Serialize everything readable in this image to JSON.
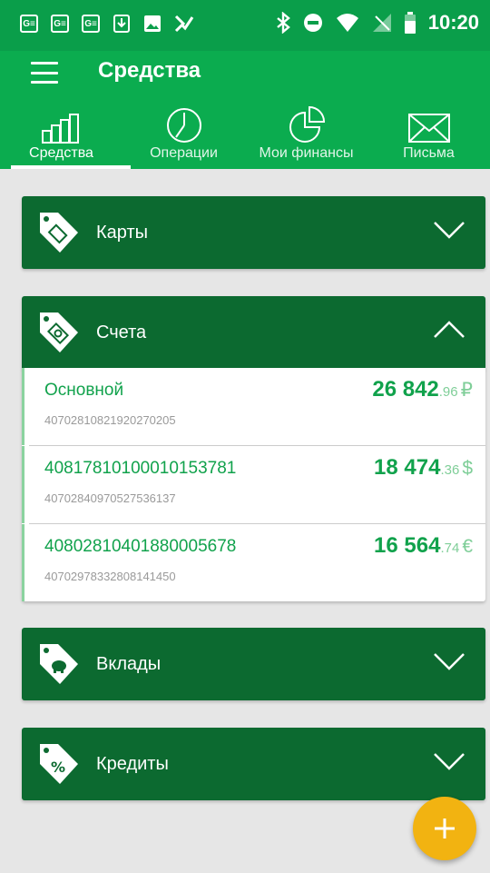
{
  "status_bar": {
    "time": "10:20",
    "left_icons": [
      "G≡",
      "G≡",
      "G≡",
      "download-icon",
      "image-icon",
      "check-icon"
    ],
    "right_icons": [
      "bluetooth-icon",
      "do-not-disturb-icon",
      "wifi-icon",
      "no-sim-icon",
      "battery-icon"
    ]
  },
  "app_bar": {
    "title": "Средства"
  },
  "tabs": [
    {
      "label": "Средства",
      "icon": "bar-chart-icon",
      "active": true
    },
    {
      "label": "Операции",
      "icon": "clock-icon",
      "active": false
    },
    {
      "label": "Мои финансы",
      "icon": "pie-chart-icon",
      "active": false
    },
    {
      "label": "Письма",
      "icon": "envelope-icon",
      "active": false
    }
  ],
  "sections": [
    {
      "label": "Карты",
      "icon": "card-tag-icon",
      "expanded": false
    },
    {
      "label": "Счета",
      "icon": "money-tag-icon",
      "expanded": true
    },
    {
      "label": "Вклады",
      "icon": "piggy-tag-icon",
      "expanded": false
    },
    {
      "label": "Кредиты",
      "icon": "percent-tag-icon",
      "expanded": false
    }
  ],
  "accounts": [
    {
      "name": "Основной",
      "number": "40702810821920270205",
      "amount_int": "26 842",
      "amount_frac": ".96",
      "currency": "₽"
    },
    {
      "name": "40817810100010153781",
      "number": "40702840970527536137",
      "amount_int": "18 474",
      "amount_frac": ".36",
      "currency": "$"
    },
    {
      "name": "40802810401880005678",
      "number": "40702978332808141450",
      "amount_int": "16 564",
      "amount_frac": ".74",
      "currency": "€"
    }
  ],
  "colors": {
    "status_bar": "#0a9e4a",
    "app_bar": "#0bac4f",
    "section_header": "#0c6a30",
    "accent_text": "#11a24c",
    "fab": "#f2b311",
    "background": "#e6e6e6"
  },
  "fab": {
    "icon": "plus-icon"
  }
}
